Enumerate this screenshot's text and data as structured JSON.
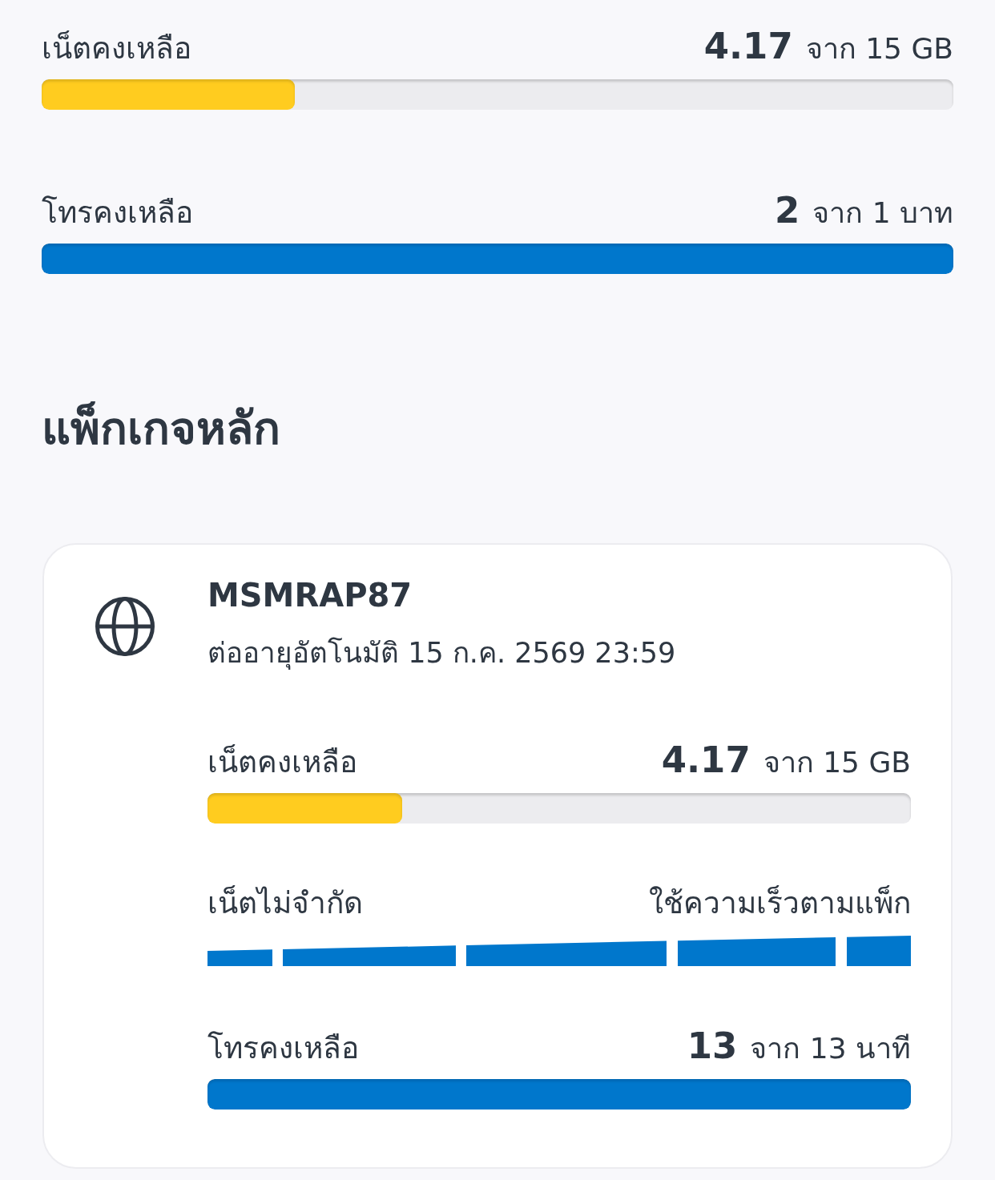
{
  "summary": [
    {
      "label": "เน็ตคงเหลือ",
      "value": "4.17",
      "total": "จาก 15 GB",
      "level": 0.278,
      "color": "#ffcc1f"
    },
    {
      "label": "โทรคงเหลือ",
      "value": "2",
      "total": "จาก 1 บาท",
      "level": 1,
      "color": "#0077cc"
    }
  ],
  "section_title": "แพ็กเกจหลัก",
  "package": {
    "name": "MSMRAP87",
    "renewal": "ต่ออายุอัตโนมัติ 15 ก.ค. 2569 23:59",
    "items": [
      {
        "kind": "meter",
        "label": "เน็ตคงเหลือ",
        "value": "4.17",
        "total": "จาก 15 GB",
        "level": 0.277,
        "color": "#ffcc1f"
      },
      {
        "kind": "unlimited",
        "label": "เน็ตไม่จำกัด",
        "note": "ใช้ความเร็วตามแพ็ก"
      },
      {
        "kind": "meter",
        "label": "โทรคงเหลือ",
        "value": "13",
        "total": "จาก 13 นาที",
        "level": 1,
        "color": "#0077cc"
      }
    ]
  }
}
